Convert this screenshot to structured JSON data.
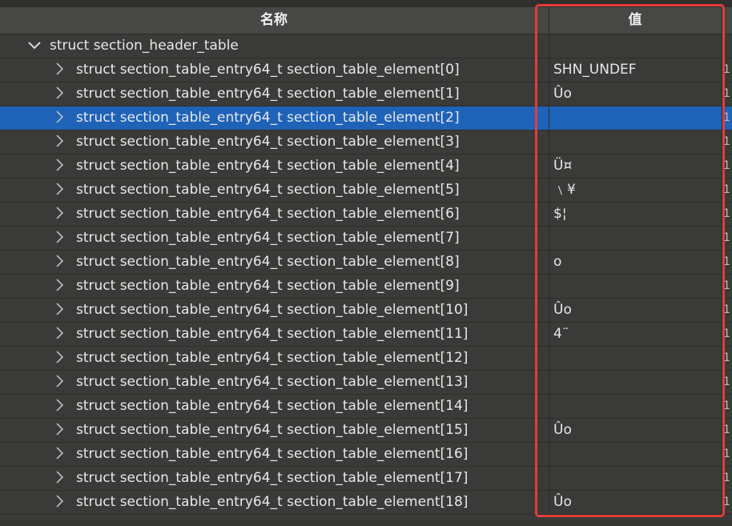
{
  "header": {
    "name_label": "名称",
    "value_label": "值"
  },
  "colors": {
    "selection": "#1e63b8",
    "highlight_box": "#e23c3c",
    "background": "#3a3a38"
  },
  "root": {
    "label": "struct section_header_table",
    "icon": "chevron-down-icon",
    "value": "",
    "extra": ""
  },
  "rows": [
    {
      "label": "struct section_table_entry64_t section_table_element[0]",
      "value": "SHN_UNDEF",
      "extra": "1"
    },
    {
      "label": "struct section_table_entry64_t section_table_element[1]",
      "value": "Ûo",
      "extra": "1"
    },
    {
      "label": "struct section_table_entry64_t section_table_element[2]",
      "value": "",
      "extra": "1",
      "selected": true
    },
    {
      "label": "struct section_table_entry64_t section_table_element[3]",
      "value": "",
      "extra": "1"
    },
    {
      "label": "struct section_table_entry64_t section_table_element[4]",
      "value": "Ü¤",
      "extra": "1"
    },
    {
      "label": "struct section_table_entry64_t section_table_element[5]",
      "value": "﹨¥",
      "extra": "1"
    },
    {
      "label": "struct section_table_entry64_t section_table_element[6]",
      "value": "$¦",
      "extra": "1"
    },
    {
      "label": "struct section_table_entry64_t section_table_element[7]",
      "value": "",
      "extra": "1"
    },
    {
      "label": "struct section_table_entry64_t section_table_element[8]",
      "value": "o",
      "extra": "1"
    },
    {
      "label": "struct section_table_entry64_t section_table_element[9]",
      "value": "",
      "extra": "1"
    },
    {
      "label": "struct section_table_entry64_t section_table_element[10]",
      "value": "Ûo",
      "extra": "1"
    },
    {
      "label": "struct section_table_entry64_t section_table_element[11]",
      "value": "4¨",
      "extra": "1"
    },
    {
      "label": "struct section_table_entry64_t section_table_element[12]",
      "value": "",
      "extra": "1"
    },
    {
      "label": "struct section_table_entry64_t section_table_element[13]",
      "value": "",
      "extra": "1"
    },
    {
      "label": "struct section_table_entry64_t section_table_element[14]",
      "value": "",
      "extra": "1"
    },
    {
      "label": "struct section_table_entry64_t section_table_element[15]",
      "value": "Ûo",
      "extra": "1"
    },
    {
      "label": "struct section_table_entry64_t section_table_element[16]",
      "value": "",
      "extra": "1"
    },
    {
      "label": "struct section_table_entry64_t section_table_element[17]",
      "value": "",
      "extra": "1"
    },
    {
      "label": "struct section_table_entry64_t section_table_element[18]",
      "value": "Ûo",
      "extra": "1"
    }
  ]
}
